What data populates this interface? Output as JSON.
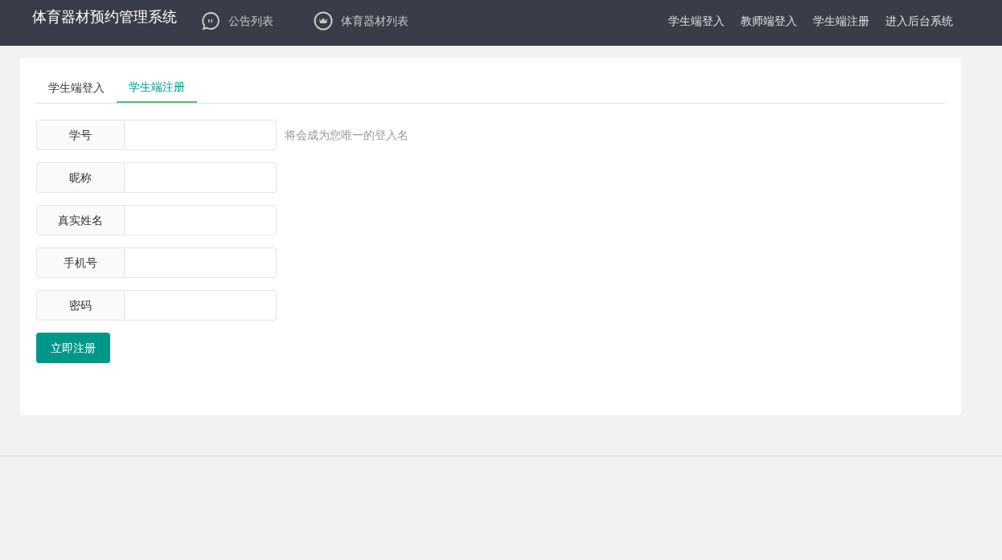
{
  "header": {
    "title": "体育器材预约管理系统",
    "nav": [
      {
        "label": "公告列表",
        "kind": "chat"
      },
      {
        "label": "体育器材列表",
        "kind": "crown"
      }
    ],
    "links": [
      "学生端登入",
      "教师端登入",
      "学生端注册",
      "进入后台系统"
    ]
  },
  "tabs": [
    {
      "label": "学生端登入",
      "selected": false
    },
    {
      "label": "学生端注册",
      "selected": true
    }
  ],
  "fields": [
    {
      "label": "学号",
      "hint": "将会成为您唯一的登入名"
    },
    {
      "label": "昵称"
    },
    {
      "label": "真实姓名"
    },
    {
      "label": "手机号"
    },
    {
      "label": "密码"
    }
  ],
  "submit": "立即注册"
}
